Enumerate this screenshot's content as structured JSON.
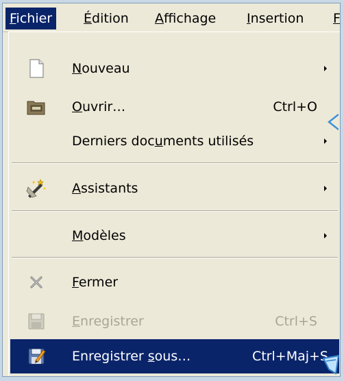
{
  "menubar": {
    "items": [
      {
        "pre": "",
        "u": "F",
        "post": "ichier"
      },
      {
        "pre": "",
        "u": "É",
        "post": "dition"
      },
      {
        "pre": "",
        "u": "A",
        "post": "ffichage"
      },
      {
        "pre": "",
        "u": "I",
        "post": "nsertion"
      },
      {
        "pre": "",
        "u": "F",
        "post": ""
      }
    ]
  },
  "menu": {
    "items": [
      {
        "pre": "",
        "u": "N",
        "post": "ouveau",
        "shortcut": "",
        "icon": "new-document-icon"
      },
      {
        "pre": "",
        "u": "O",
        "post": "uvrir…",
        "shortcut": "Ctrl+O",
        "icon": "open-folder-icon"
      },
      {
        "pre": "Derniers doc",
        "u": "u",
        "post": "ments utilisés",
        "shortcut": "",
        "icon": ""
      },
      {
        "pre": "",
        "u": "A",
        "post": "ssistants",
        "shortcut": "",
        "icon": "wizard-icon"
      },
      {
        "pre": "",
        "u": "M",
        "post": "odèles",
        "shortcut": "",
        "icon": ""
      },
      {
        "pre": "",
        "u": "F",
        "post": "ermer",
        "shortcut": "",
        "icon": "close-x-icon"
      },
      {
        "pre": "",
        "u": "E",
        "post": "nregistrer",
        "shortcut": "Ctrl+S",
        "icon": "save-icon"
      },
      {
        "pre": "Enregistrer ",
        "u": "s",
        "post": "ous…",
        "shortcut": "Ctrl+Maj+S",
        "icon": "save-as-icon"
      }
    ]
  },
  "colors": {
    "highlight": "#0a246a",
    "menu_bg": "#ece9d8",
    "disabled_text": "#a7a696",
    "callout_accent": "#3a8fd9"
  }
}
